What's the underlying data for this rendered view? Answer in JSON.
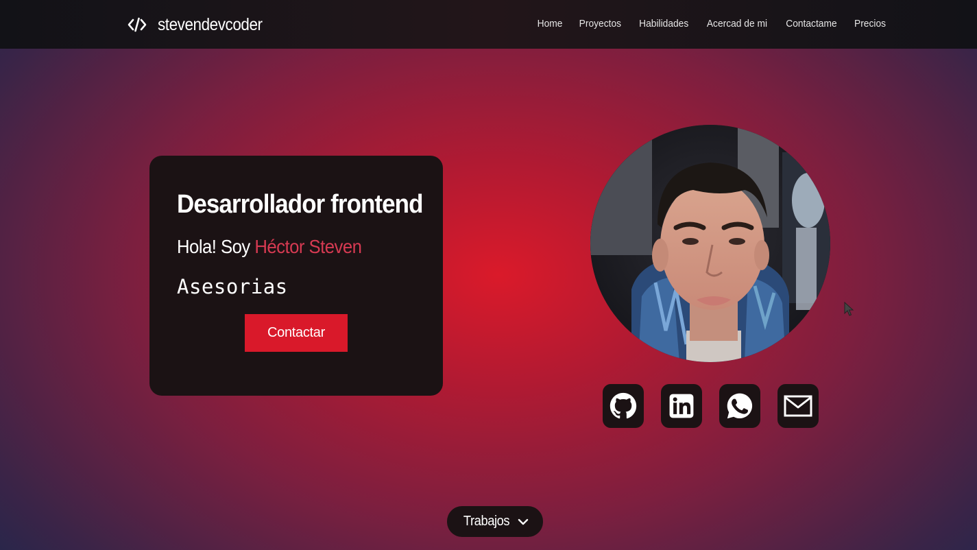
{
  "header": {
    "brand_icon": "code-icon",
    "brand": "stevendevcoder",
    "nav": [
      "Home",
      "Proyectos",
      "Habilidades",
      "Acercad de mi",
      "Contactame",
      "Precios"
    ]
  },
  "hero": {
    "title": "Desarrollador frontend",
    "greeting": "Hola! Soy ",
    "name": "Héctor Steven",
    "typed_text": "Asesorias",
    "cta_label": "Contactar"
  },
  "social": [
    "github-icon",
    "linkedin-icon",
    "whatsapp-icon",
    "mail-icon"
  ],
  "footer": {
    "trabajos_label": "Trabajos",
    "trabajos_icon": "chevron-down-icon"
  },
  "colors": {
    "accent": "#d9192a",
    "name_highlight": "#d63a52",
    "card_bg": "#1b1214"
  }
}
